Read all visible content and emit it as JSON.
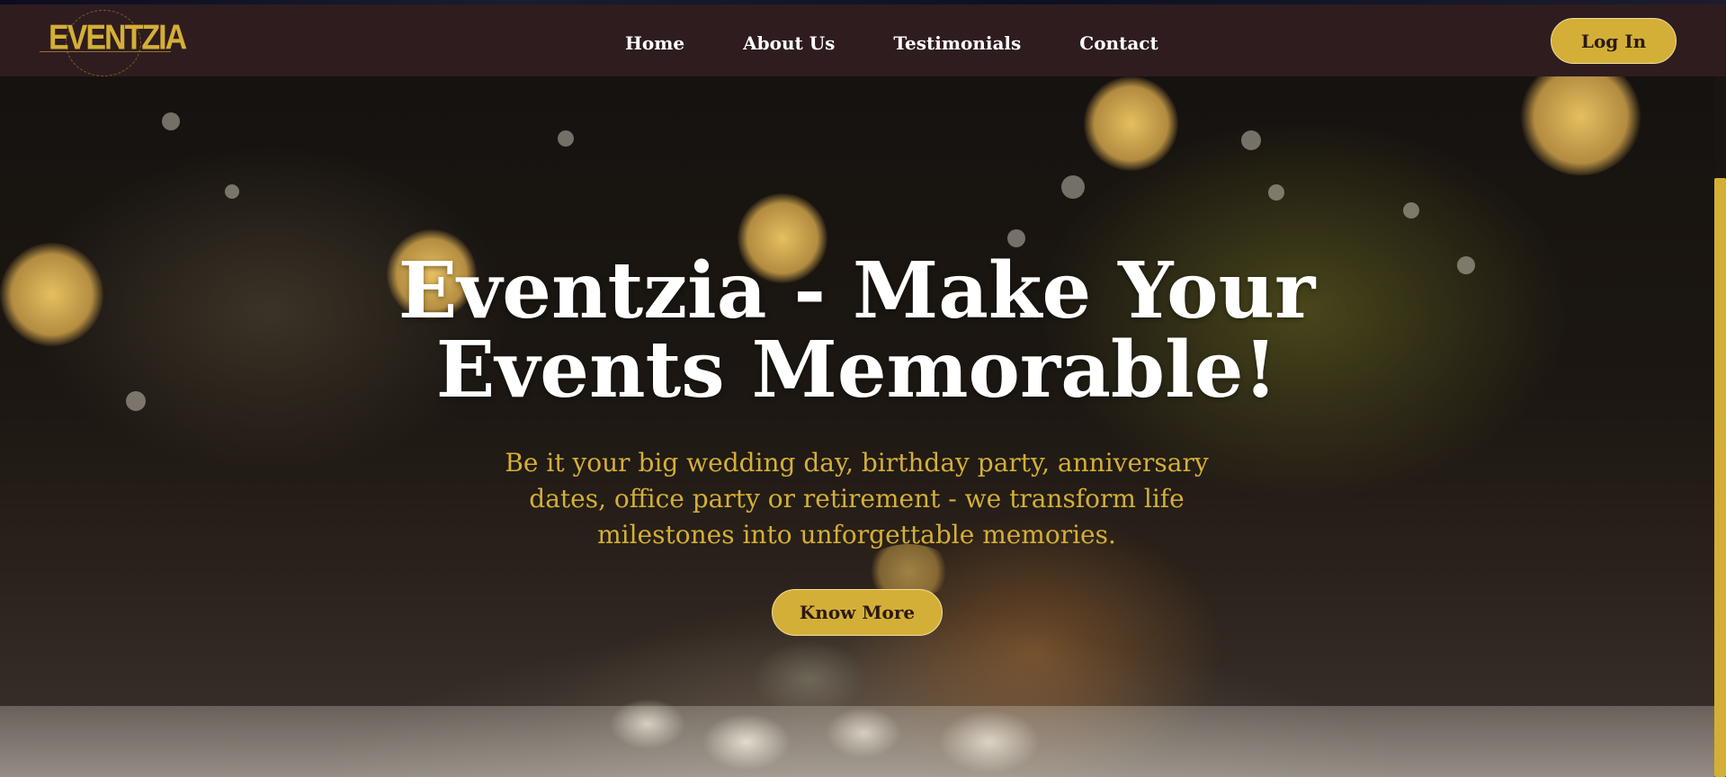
{
  "brand": {
    "logo_text": "EVENTZIA",
    "accent_color": "#d4af37",
    "header_bg": "#2f1c1f"
  },
  "nav": {
    "items": [
      {
        "label": "Home"
      },
      {
        "label": "About Us"
      },
      {
        "label": "Testimonials"
      },
      {
        "label": "Contact"
      }
    ],
    "login_label": "Log In"
  },
  "hero": {
    "title": "Eventzia - Make Your Events Memorable!",
    "subtitle": "Be it your big wedding day, birthday party, anniversary dates, office party or retirement - we transform life milestones into unforgettable memories.",
    "cta_label": "Know More"
  },
  "icons": {
    "logo": "eventzia-logo"
  }
}
